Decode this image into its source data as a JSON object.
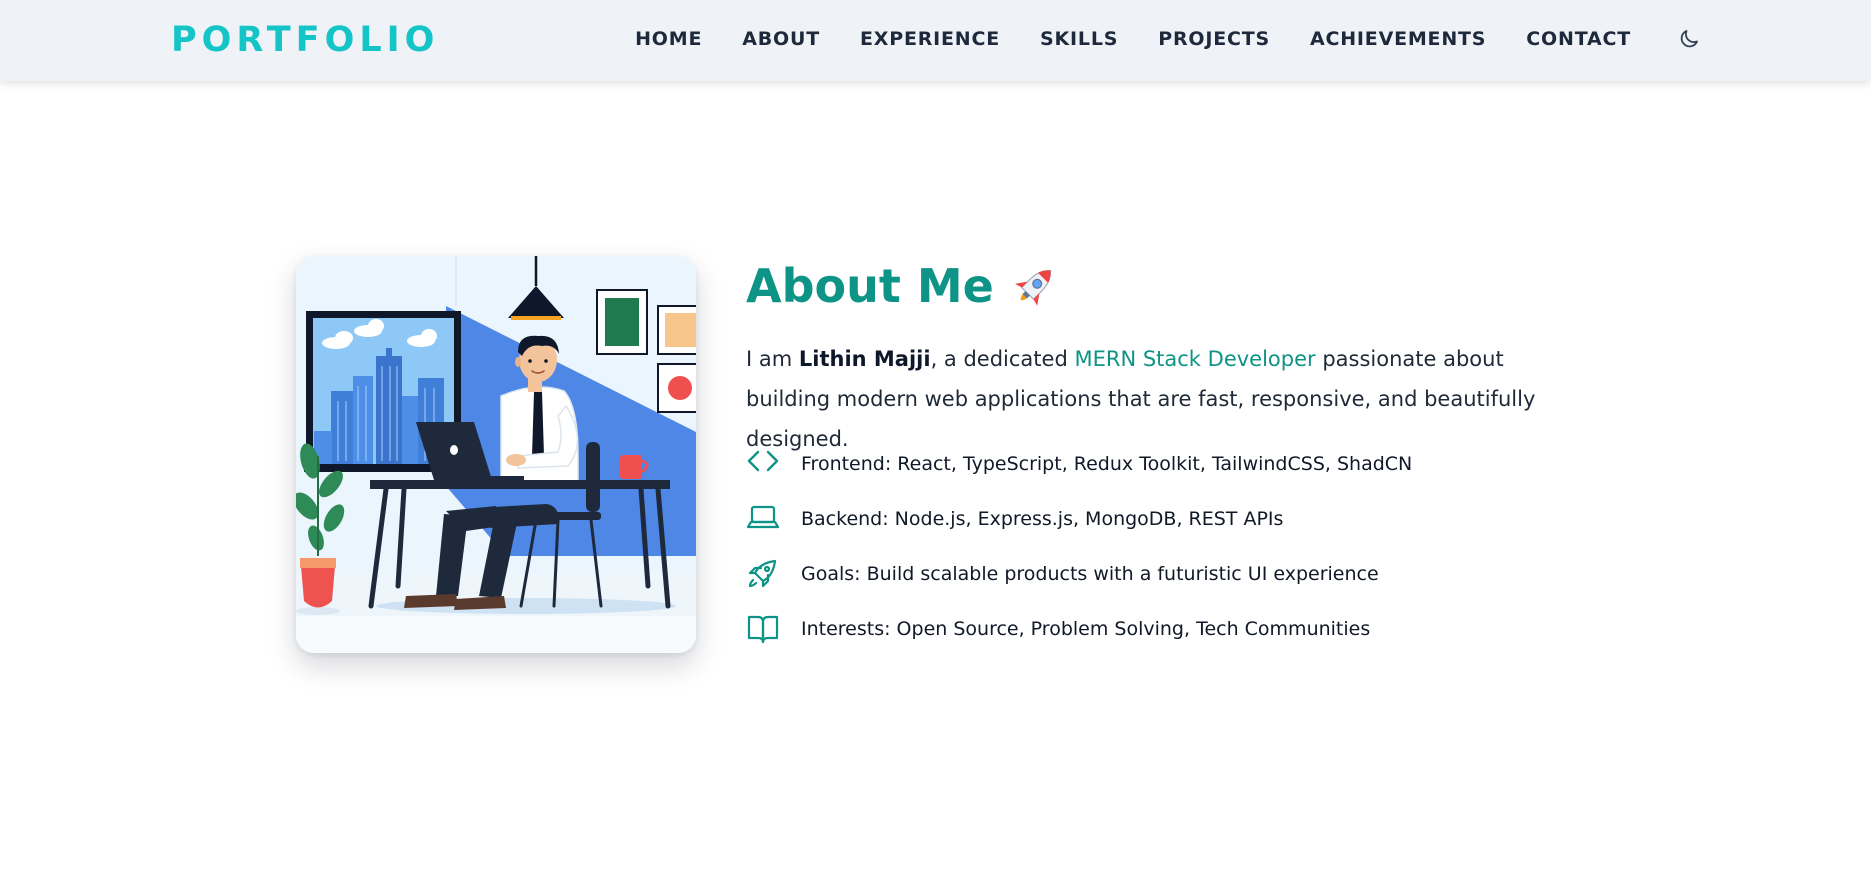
{
  "nav": {
    "brand": "PORTFOLIO",
    "links": [
      "HOME",
      "ABOUT",
      "EXPERIENCE",
      "SKILLS",
      "PROJECTS",
      "ACHIEVEMENTS",
      "CONTACT"
    ],
    "theme_toggle_icon": "moon-icon"
  },
  "about": {
    "title": "About Me",
    "title_icon": "rocket-icon",
    "intro": {
      "prefix": "I am ",
      "name": "Lithin Majji",
      "middle": ", a dedicated ",
      "role": "MERN Stack Developer",
      "suffix": " passionate about building modern web applications that are fast, responsive, and beautifully designed."
    },
    "items": [
      {
        "icon": "code-icon",
        "text": "Frontend: React, TypeScript, Redux Toolkit, TailwindCSS, ShadCN"
      },
      {
        "icon": "laptop-icon",
        "text": "Backend: Node.js, Express.js, MongoDB, REST APIs"
      },
      {
        "icon": "rocket-outline-icon",
        "text": "Goals: Build scalable products with a futuristic UI experience"
      },
      {
        "icon": "book-open-icon",
        "text": "Interests: Open Source, Problem Solving, Tech Communities"
      }
    ]
  },
  "colors": {
    "brand": "#14c4c6",
    "accent": "#0e9486",
    "nav_bg": "#eff3f8",
    "text": "#1e293b"
  }
}
